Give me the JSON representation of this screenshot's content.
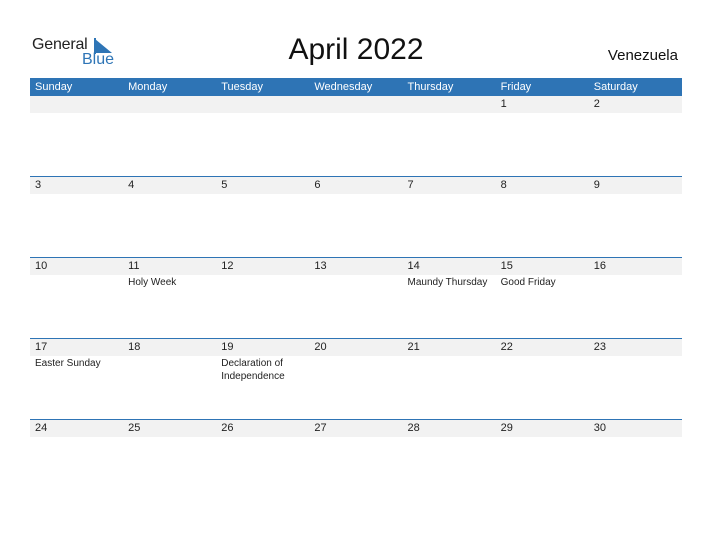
{
  "logo": {
    "text_general": "General",
    "text_blue": "Blue"
  },
  "title": "April 2022",
  "country": "Venezuela",
  "colors": {
    "accent": "#2e74b5",
    "row_shade": "#f2f2f2"
  },
  "weekdays": [
    "Sunday",
    "Monday",
    "Tuesday",
    "Wednesday",
    "Thursday",
    "Friday",
    "Saturday"
  ],
  "weeks": [
    {
      "days": [
        {
          "d": "",
          "e": ""
        },
        {
          "d": "",
          "e": ""
        },
        {
          "d": "",
          "e": ""
        },
        {
          "d": "",
          "e": ""
        },
        {
          "d": "",
          "e": ""
        },
        {
          "d": "1",
          "e": ""
        },
        {
          "d": "2",
          "e": ""
        }
      ]
    },
    {
      "days": [
        {
          "d": "3",
          "e": ""
        },
        {
          "d": "4",
          "e": ""
        },
        {
          "d": "5",
          "e": ""
        },
        {
          "d": "6",
          "e": ""
        },
        {
          "d": "7",
          "e": ""
        },
        {
          "d": "8",
          "e": ""
        },
        {
          "d": "9",
          "e": ""
        }
      ]
    },
    {
      "days": [
        {
          "d": "10",
          "e": ""
        },
        {
          "d": "11",
          "e": "Holy Week"
        },
        {
          "d": "12",
          "e": ""
        },
        {
          "d": "13",
          "e": ""
        },
        {
          "d": "14",
          "e": "Maundy Thursday"
        },
        {
          "d": "15",
          "e": "Good Friday"
        },
        {
          "d": "16",
          "e": ""
        }
      ]
    },
    {
      "days": [
        {
          "d": "17",
          "e": "Easter Sunday"
        },
        {
          "d": "18",
          "e": ""
        },
        {
          "d": "19",
          "e": "Declaration of Independence"
        },
        {
          "d": "20",
          "e": ""
        },
        {
          "d": "21",
          "e": ""
        },
        {
          "d": "22",
          "e": ""
        },
        {
          "d": "23",
          "e": ""
        }
      ]
    },
    {
      "days": [
        {
          "d": "24",
          "e": ""
        },
        {
          "d": "25",
          "e": ""
        },
        {
          "d": "26",
          "e": ""
        },
        {
          "d": "27",
          "e": ""
        },
        {
          "d": "28",
          "e": ""
        },
        {
          "d": "29",
          "e": ""
        },
        {
          "d": "30",
          "e": ""
        }
      ]
    }
  ]
}
